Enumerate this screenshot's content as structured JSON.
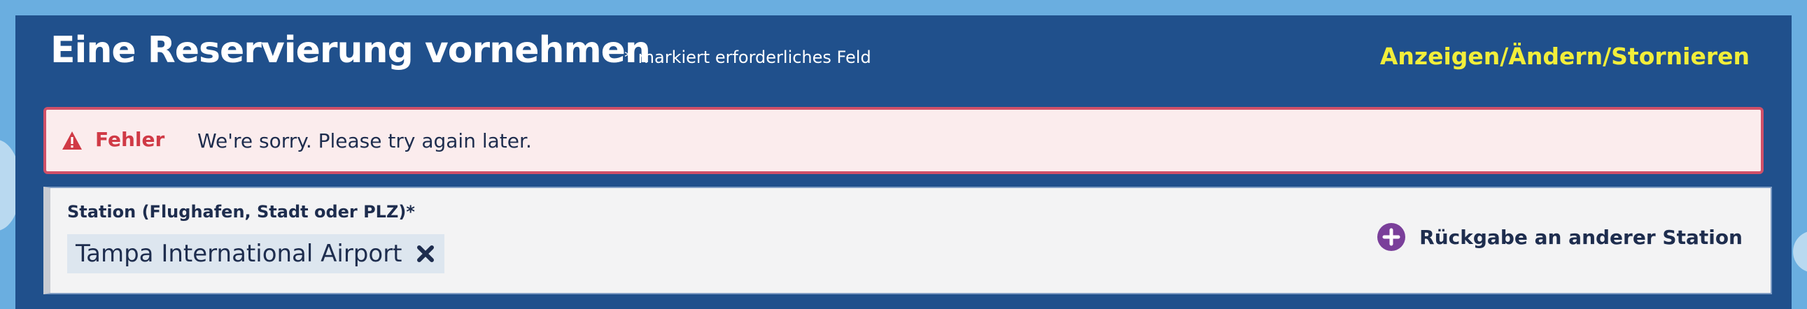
{
  "header": {
    "title": "Eine Reservierung vornehmen",
    "required_note": "* markiert erforderliches Feld",
    "manage_link": "Anzeigen/Ändern/Stornieren"
  },
  "error": {
    "label": "Fehler",
    "message": "We're sorry. Please try again later."
  },
  "station": {
    "label": "Station (Flughafen, Stadt oder PLZ)*",
    "value": "Tampa International Airport",
    "return_label": "Rückgabe an anderer Station"
  },
  "colors": {
    "background": "#6aaee0",
    "panel": "#20508c",
    "link_yellow": "#f2ee3a",
    "error_red": "#d03a46",
    "error_bg": "#fbeced",
    "plus_purple": "#7a3f9a",
    "text_dark": "#1e2d4e"
  },
  "icons": {
    "error": "warning-icon",
    "remove": "close-icon",
    "add": "plus-circle-icon"
  }
}
